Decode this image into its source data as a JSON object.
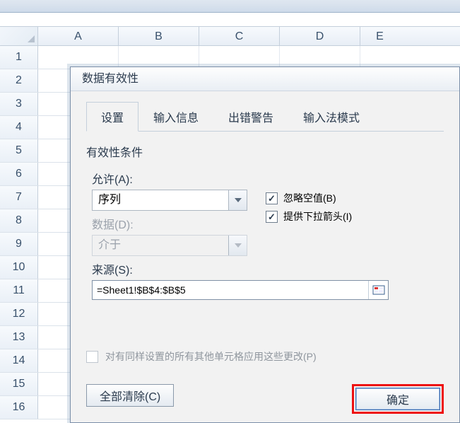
{
  "columns": [
    "A",
    "B",
    "C",
    "D",
    "E"
  ],
  "rows": [
    "1",
    "2",
    "3",
    "4",
    "5",
    "6",
    "7",
    "8",
    "9",
    "10",
    "11",
    "12",
    "13",
    "14",
    "15",
    "16"
  ],
  "dialog": {
    "title": "数据有效性",
    "tabs": {
      "settings": "设置",
      "input_msg": "输入信息",
      "error_alert": "出错警告",
      "ime_mode": "输入法模式"
    },
    "group_title": "有效性条件",
    "allow_label": "允许(A):",
    "allow_value": "序列",
    "data_label": "数据(D):",
    "data_value": "介于",
    "ignore_blank": "忽略空值(B)",
    "dropdown_arrow": "提供下拉箭头(I)",
    "source_label": "来源(S):",
    "source_value": "=Sheet1!$B$4:$B$5",
    "apply_others": "对有同样设置的所有其他单元格应用这些更改(P)",
    "clear_all": "全部清除(C)",
    "ok": "确定"
  }
}
